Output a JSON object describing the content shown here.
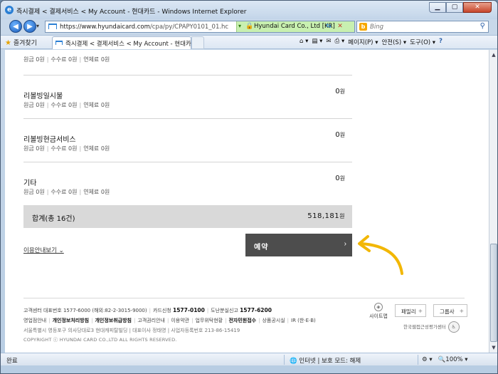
{
  "window": {
    "title": "즉시결제 < 결제서비스 < My Account - 현대카드 - Windows Internet Explorer",
    "min_icon": "minimize-icon",
    "max_icon": "maximize-icon",
    "close_icon": "close-icon"
  },
  "address_bar": {
    "url_host": "https://www.hyundaicard.com",
    "url_path": "/cpa/py/CPAPY0101_01.hc",
    "cert_label": "Hyundai Card Co., Ltd [KR]",
    "search_placeholder": "Bing"
  },
  "favorites_bar": {
    "favorites_label": "즐겨찾기",
    "tab_title": "즉시결제 < 결제서비스 < My Account - 현대카드",
    "page_menu": "페이지(P) ▾",
    "safety_menu": "안전(S) ▾",
    "tools_menu": "도구(O) ▾",
    "help_icon": "?"
  },
  "payment_items": [
    {
      "name": "리볼빙일시불",
      "amount": "0",
      "unit": "원",
      "principal": "원금 0원",
      "fee": "수수료 0원",
      "late_fee": "연체료 0원"
    },
    {
      "name": "리볼빙현금서비스",
      "amount": "0",
      "unit": "원",
      "principal": "원금 0원",
      "fee": "수수료 0원",
      "late_fee": "연체료 0원"
    },
    {
      "name": "기타",
      "amount": "0",
      "unit": "원",
      "principal": "원금 0원",
      "fee": "수수료 0원",
      "late_fee": "연체료 0원"
    }
  ],
  "partial_item": {
    "principal": "원금 0원",
    "fee": "수수료 0원",
    "late_fee": "연체료 0원"
  },
  "total": {
    "label": "합계(총 16건)",
    "amount": "518,181",
    "unit": "원"
  },
  "actions": {
    "guide_link": "이용안내보기 ⌄",
    "reserve_label": "예약",
    "reserve_chevron": "›"
  },
  "footer": {
    "line1_a": "고객센터 대표번호 1577-6000 (해외:82-2-3015-9000)",
    "line1_b_label": "카드신청",
    "line1_b_num": "1577-0100",
    "line1_c_label": "도난분실신고",
    "line1_c_num": "1577-6200",
    "links": [
      "영업점안내",
      "개인정보처리방침",
      "개인정보취급방침",
      "고객권리안내",
      "이용약관",
      "업무위탁현황",
      "전자민원접수",
      "상품공시실",
      "IR (한·E·B)"
    ],
    "address": "서울특별시 영등포구 의사당대로3 현대캐피탈빌딩 | 대표이사 정태영 | 사업자등록번호 213-86-15419",
    "copyright": "COPYRIGHT ⓒ HYUNDAI CARD CO.,LTD ALL RIGHTS RESERVED.",
    "sitemap_label": "사이트맵",
    "family_1": "패밀리",
    "family_2": "그룹사",
    "award_text": "한국웹접근성평가센터"
  },
  "status_bar": {
    "status": "완료",
    "zone": "인터넷 | 보호 모드: 해제",
    "zoom": "100%"
  },
  "colors": {
    "reserve_button": "#4d4d4d",
    "total_bar": "#d9d9d9",
    "annotation_arrow": "#f2b705",
    "secure_zone": "#c8f0b0"
  }
}
